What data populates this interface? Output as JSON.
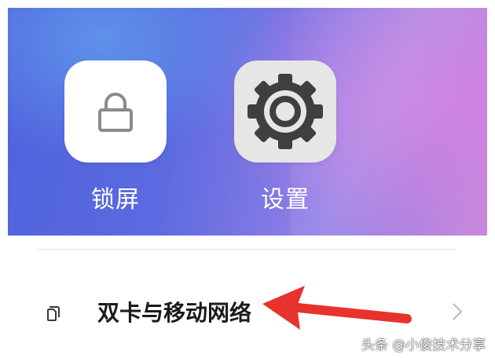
{
  "apps": [
    {
      "label": "锁屏",
      "icon": "lock-icon"
    },
    {
      "label": "设置",
      "icon": "gear-icon"
    }
  ],
  "settings_row": {
    "label": "双卡与移动网络",
    "icon": "dual-sim-icon",
    "trailing_icon": "chevron-right-icon"
  },
  "annotation": {
    "icon": "red-arrow",
    "color": "#e8322c"
  },
  "watermark": "头条 @小俊技术分享",
  "colors": {
    "label_text": "#1b1b1b",
    "wallpaper_blue": "#4f63dd",
    "wallpaper_purple": "#c889dc"
  }
}
